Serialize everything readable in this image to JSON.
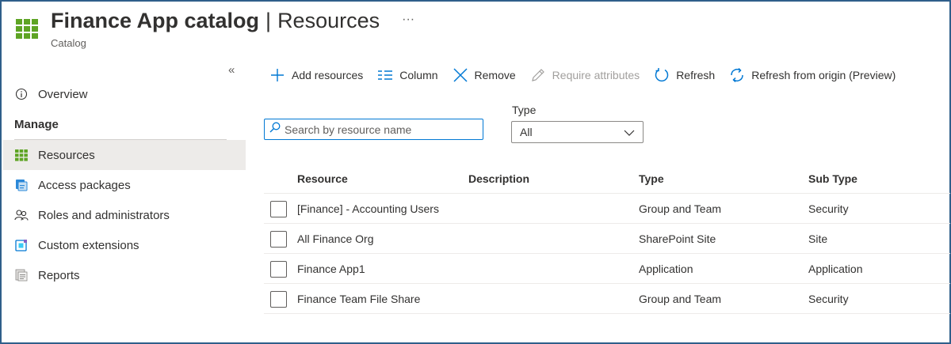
{
  "header": {
    "title_main": "Finance App catalog",
    "title_separator": "|",
    "title_section": "Resources",
    "more": "···",
    "subtitle": "Catalog",
    "icon": "catalog-grid-icon"
  },
  "sidebar": {
    "collapse": "«",
    "overview": "Overview",
    "section_manage": "Manage",
    "items": [
      {
        "label": "Resources",
        "icon": "resources-grid-icon",
        "active": true
      },
      {
        "label": "Access packages",
        "icon": "access-packages-icon"
      },
      {
        "label": "Roles and administrators",
        "icon": "roles-icon"
      },
      {
        "label": "Custom extensions",
        "icon": "custom-extensions-icon"
      },
      {
        "label": "Reports",
        "icon": "reports-icon"
      }
    ]
  },
  "toolbar": {
    "add": "Add resources",
    "column": "Column",
    "remove": "Remove",
    "require": "Require attributes",
    "refresh": "Refresh",
    "refresh_origin": "Refresh from origin (Preview)"
  },
  "filters": {
    "search_placeholder": "Search by resource name",
    "type_label": "Type",
    "type_value": "All"
  },
  "table": {
    "headers": {
      "resource": "Resource",
      "description": "Description",
      "type": "Type",
      "subtype": "Sub Type"
    },
    "rows": [
      {
        "resource": "[Finance] - Accounting Users",
        "description": "",
        "type": "Group and Team",
        "subtype": "Security"
      },
      {
        "resource": "All Finance Org",
        "description": "",
        "type": "SharePoint Site",
        "subtype": "Site"
      },
      {
        "resource": "Finance App1",
        "description": "",
        "type": "Application",
        "subtype": "Application"
      },
      {
        "resource": "Finance Team File Share",
        "description": "",
        "type": "Group and Team",
        "subtype": "Security"
      }
    ]
  },
  "colors": {
    "accent": "#0078d4",
    "grid_green": "#5ea424",
    "frame": "#2f5f8a"
  }
}
